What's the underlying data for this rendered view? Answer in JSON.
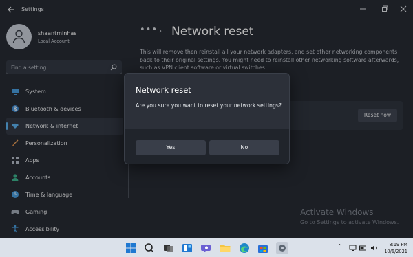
{
  "titlebar": {
    "title": "Settings"
  },
  "profile": {
    "name": "shaantminhas",
    "account_type": "Local Account"
  },
  "search": {
    "placeholder": "Find a setting"
  },
  "nav": {
    "items": [
      {
        "label": "System",
        "icon": "monitor-icon"
      },
      {
        "label": "Bluetooth & devices",
        "icon": "bluetooth-icon"
      },
      {
        "label": "Network & internet",
        "icon": "wifi-icon",
        "active": true
      },
      {
        "label": "Personalization",
        "icon": "brush-icon"
      },
      {
        "label": "Apps",
        "icon": "apps-icon"
      },
      {
        "label": "Accounts",
        "icon": "person-icon"
      },
      {
        "label": "Time & language",
        "icon": "globe-clock-icon"
      },
      {
        "label": "Gaming",
        "icon": "gamepad-icon"
      },
      {
        "label": "Accessibility",
        "icon": "accessibility-icon"
      }
    ]
  },
  "main": {
    "breadcrumb_dots": "•••",
    "page_title": "Network reset",
    "description": "This will remove then reinstall all your network adapters, and set other networking components back to their original settings. You might need to reinstall other networking software afterwards, such as VPN client software or virtual switches.",
    "reset_button": "Reset now"
  },
  "dialog": {
    "title": "Network reset",
    "message": "Are you sure you want to reset your network settings?",
    "yes": "Yes",
    "no": "No"
  },
  "watermark": {
    "title": "Activate Windows",
    "subtitle": "Go to Settings to activate Windows."
  },
  "taskbar": {
    "time": "8:19 PM",
    "date": "10/6/2021"
  },
  "colors": {
    "window_bg": "#272b34",
    "accent": "#5eb3f0",
    "taskbar_bg": "#dbe1ea"
  }
}
